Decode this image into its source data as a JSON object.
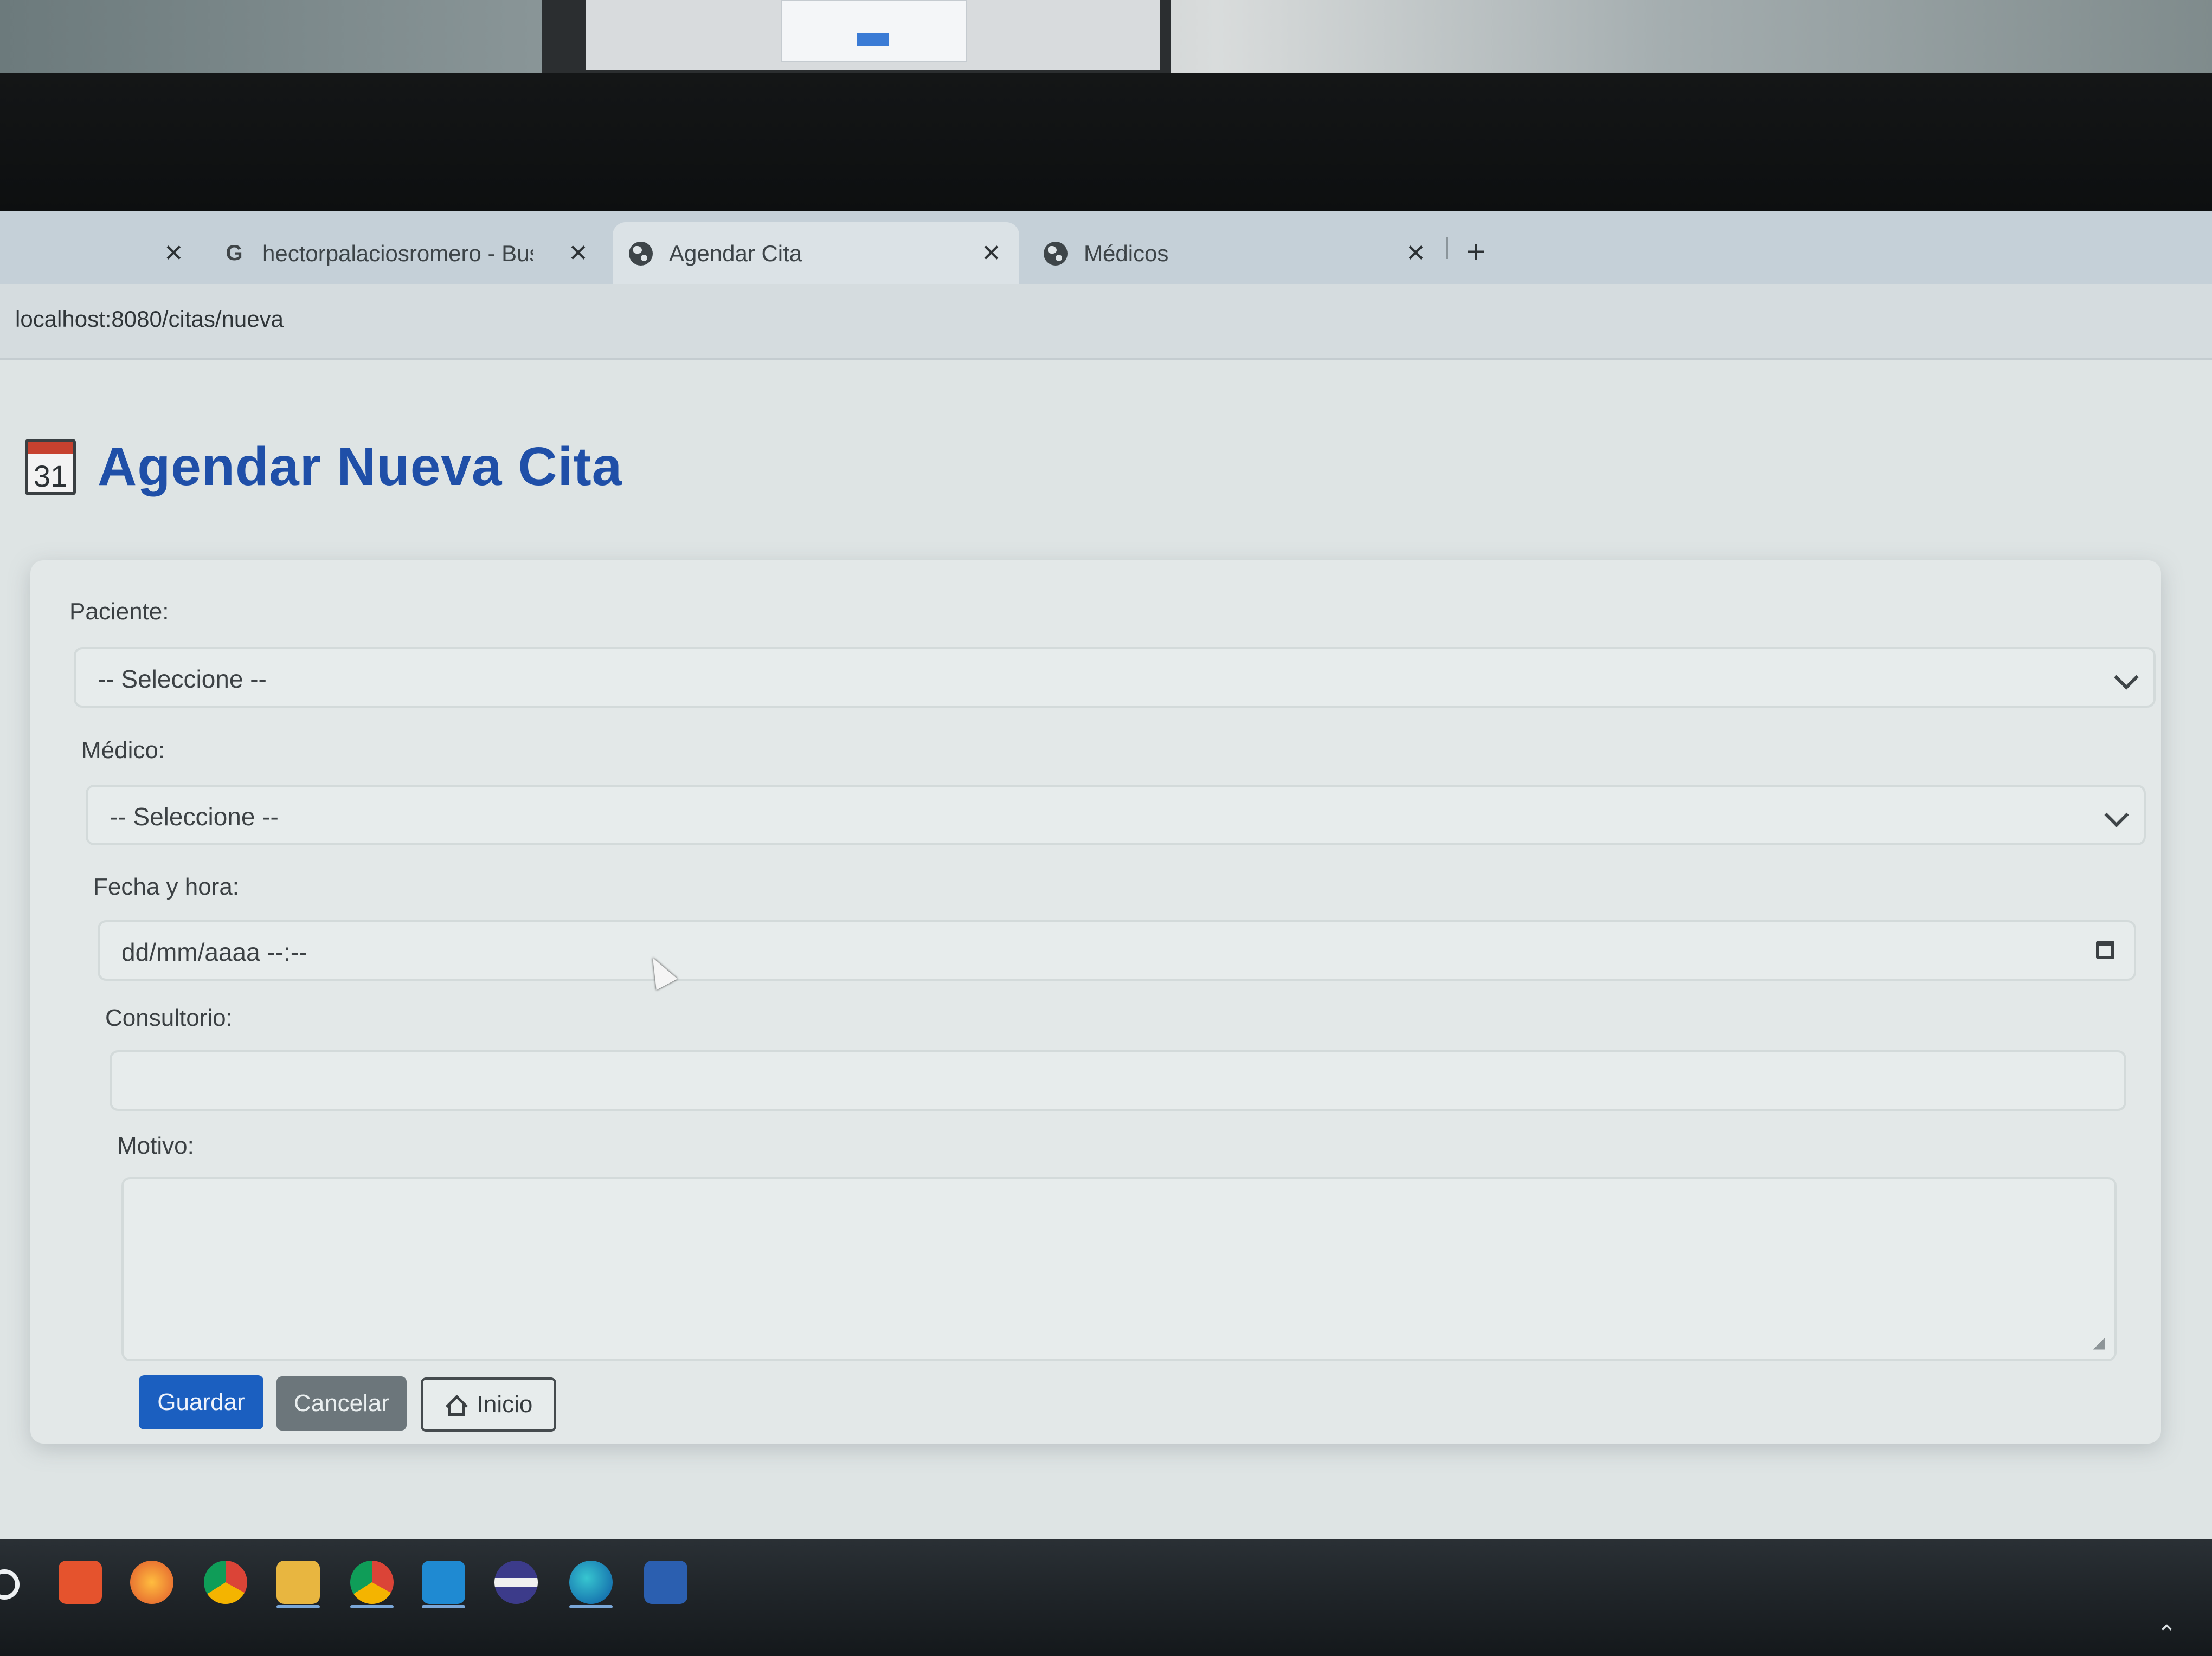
{
  "browser": {
    "tabs": [
      {
        "title": "",
        "close_label": "✕",
        "icon": "blank-icon",
        "active": false
      },
      {
        "title": "hectorpalaciosromero - Buscar",
        "close_label": "✕",
        "icon": "google-icon",
        "active": false
      },
      {
        "title": "Agendar Cita",
        "close_label": "✕",
        "icon": "globe-icon",
        "active": true
      },
      {
        "title": "Médicos",
        "close_label": "✕",
        "icon": "globe-icon",
        "active": false
      }
    ],
    "new_tab_label": "+",
    "google_letter": "G",
    "url": "localhost:8080/citas/nueva"
  },
  "page": {
    "icon": "calendar-icon",
    "calendar_day": "31",
    "title": "Agendar Nueva Cita"
  },
  "form": {
    "paciente_label": "Paciente:",
    "paciente_value": "-- Seleccione --",
    "medico_label": "Médico:",
    "medico_value": "-- Seleccione --",
    "fecha_label": "Fecha y hora:",
    "fecha_placeholder": "dd/mm/aaaa --:--",
    "consultorio_label": "Consultorio:",
    "consultorio_value": "",
    "motivo_label": "Motivo:",
    "motivo_value": ""
  },
  "buttons": {
    "guardar": "Guardar",
    "cancelar": "Cancelar",
    "inicio": "Inicio"
  },
  "colors": {
    "title_blue": "#1f4fa8",
    "primary_button": "#1b5fc0",
    "secondary_button": "#6c767b"
  },
  "taskbar": {
    "apps": [
      "brave-icon",
      "firefox-icon",
      "chrome-icon",
      "file-explorer-icon",
      "chrome-icon",
      "vscode-icon",
      "eclipse-icon",
      "edge-icon",
      "app-icon"
    ]
  }
}
